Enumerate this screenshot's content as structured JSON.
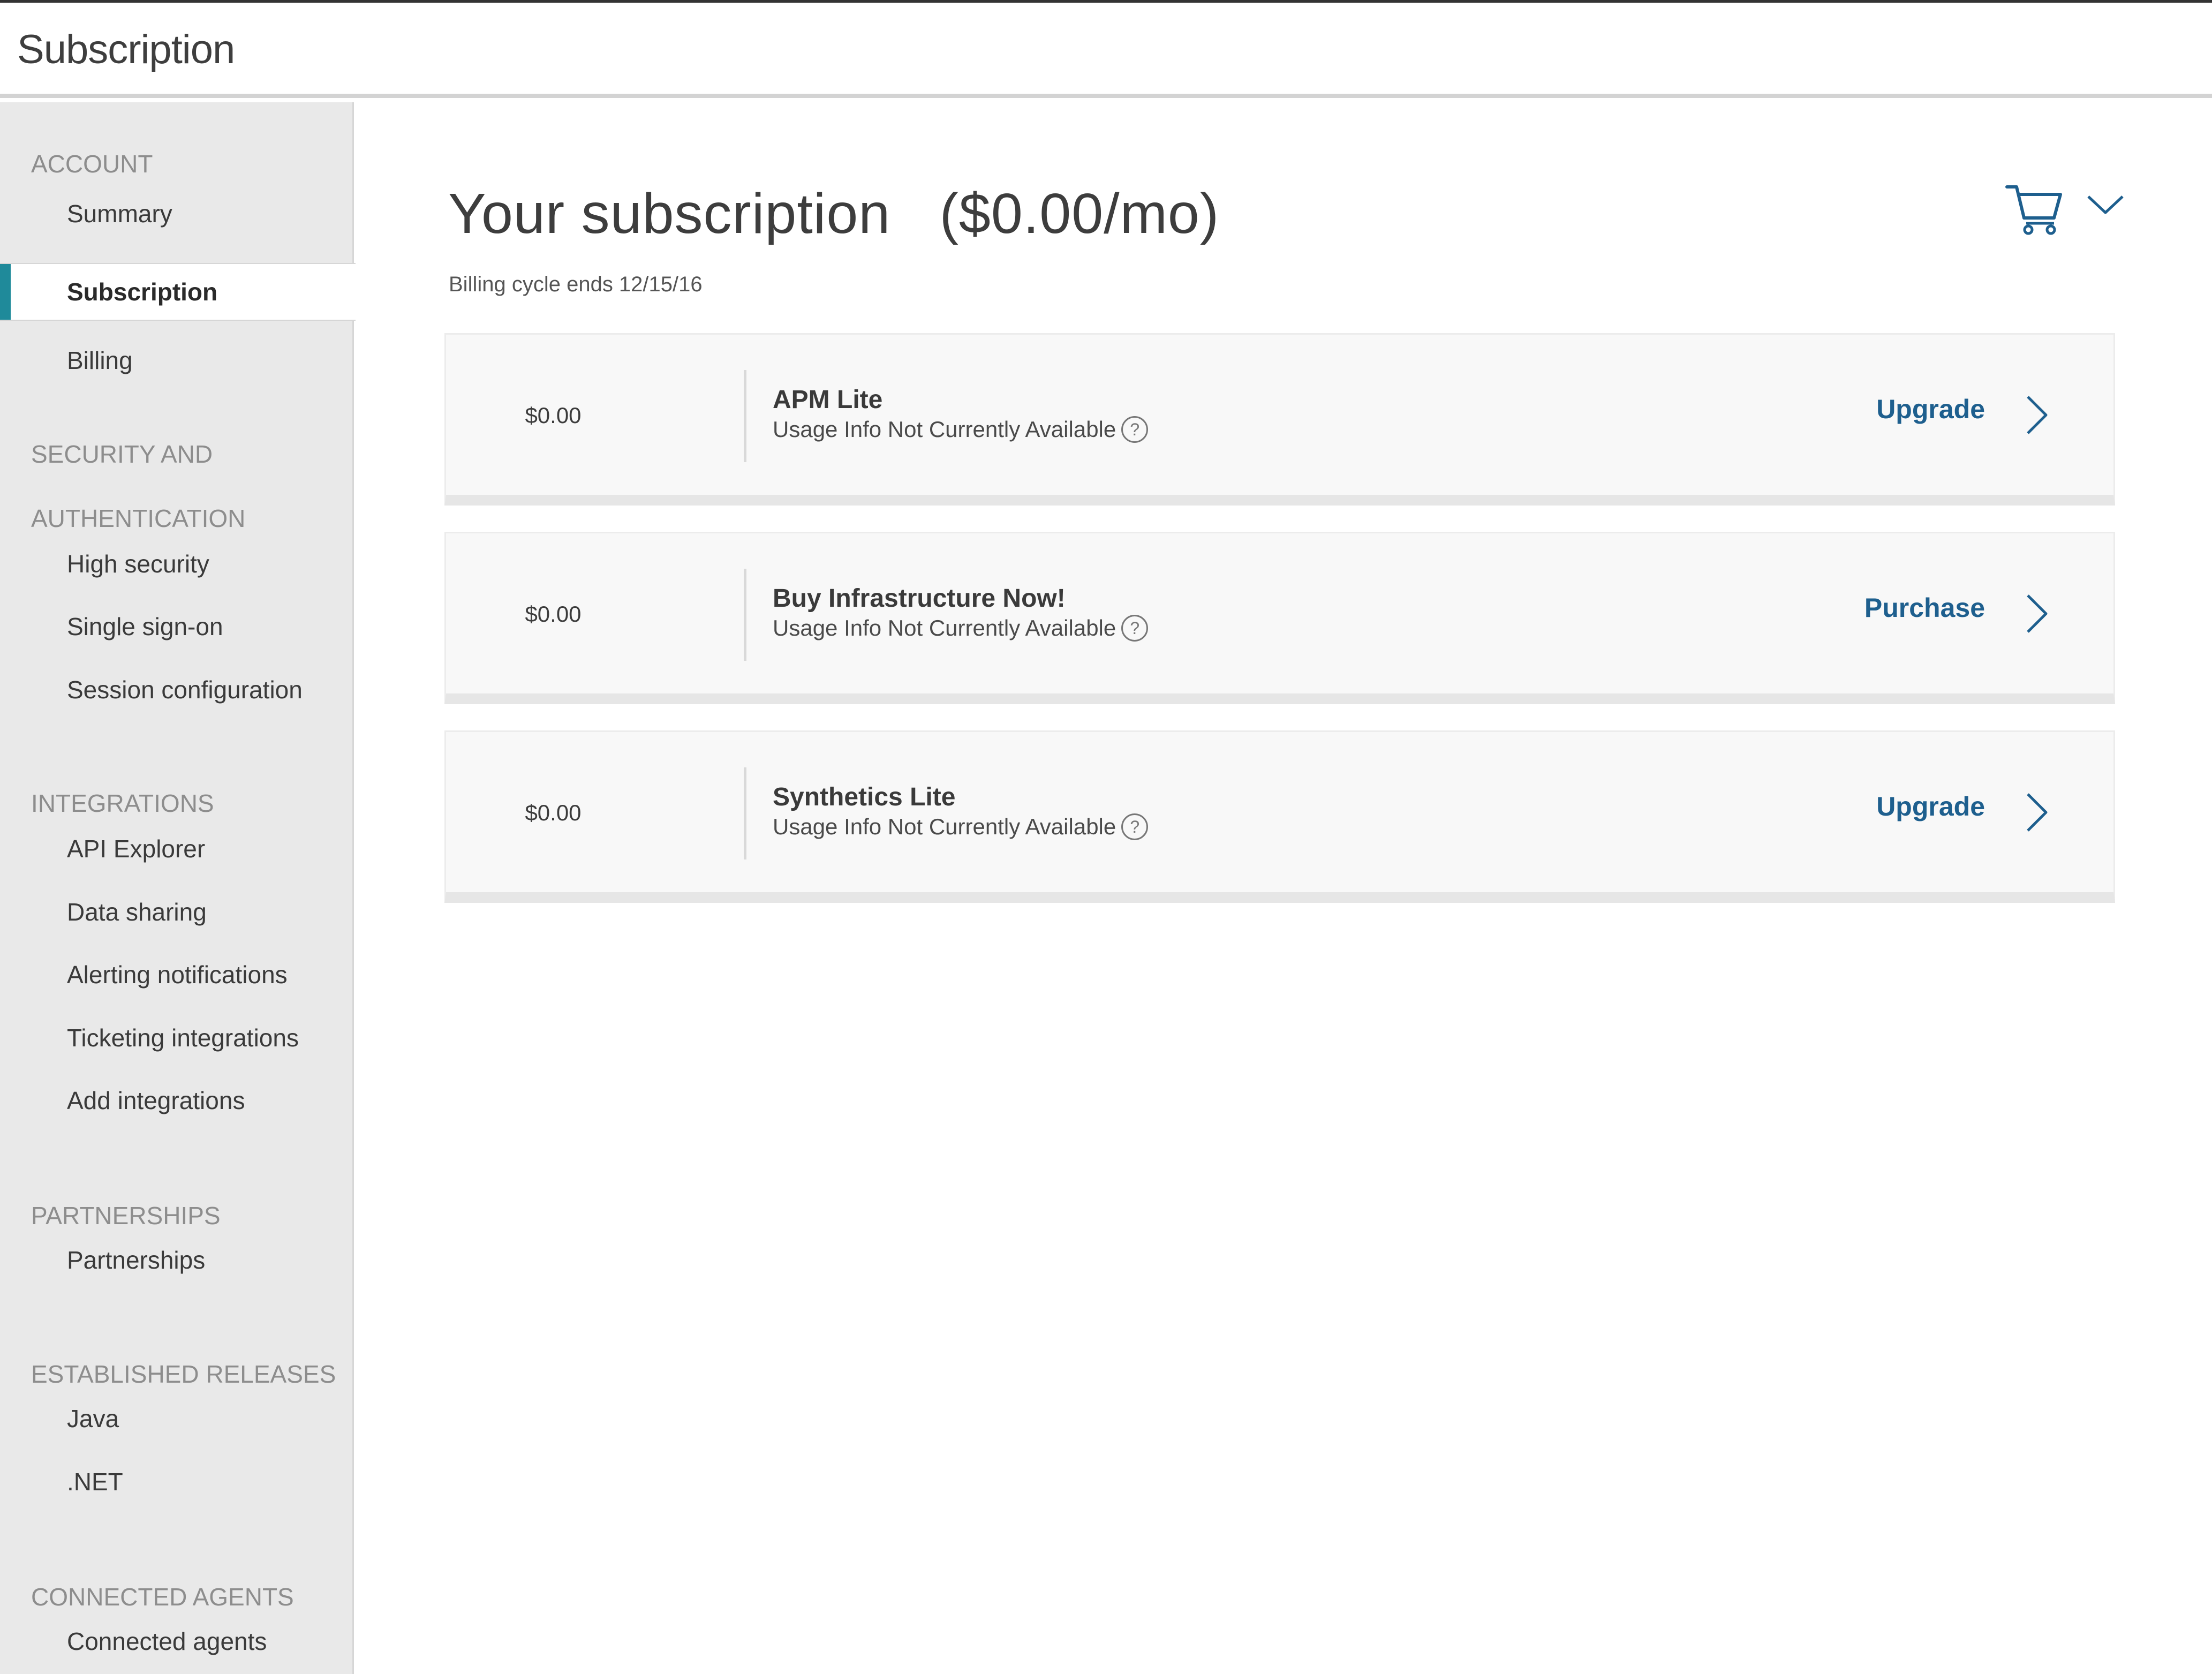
{
  "header": {
    "title": "Subscription"
  },
  "sidebar": {
    "sections": [
      {
        "title": "ACCOUNT",
        "items": [
          "Summary",
          "Subscription",
          "Billing"
        ]
      },
      {
        "title_lines": [
          "SECURITY AND",
          "AUTHENTICATION"
        ],
        "items": [
          "High security",
          "Single sign-on",
          "Session configuration"
        ]
      },
      {
        "title": "INTEGRATIONS",
        "items": [
          "API Explorer",
          "Data sharing",
          "Alerting notifications",
          "Ticketing integrations",
          "Add integrations"
        ]
      },
      {
        "title": "PARTNERSHIPS",
        "items": [
          "Partnerships"
        ]
      },
      {
        "title": "ESTABLISHED RELEASES",
        "items": [
          "Java",
          ".NET"
        ]
      },
      {
        "title": "CONNECTED AGENTS",
        "items": [
          "Connected agents"
        ]
      }
    ],
    "active_item": "Subscription"
  },
  "main": {
    "title": "Your subscription",
    "price_per_month": "($0.00/mo)",
    "billing_cycle": "Billing cycle ends 12/15/16",
    "products": [
      {
        "price": "$0.00",
        "name": "APM Lite",
        "usage": "Usage Info Not Currently Available",
        "action": "Upgrade"
      },
      {
        "price": "$0.00",
        "name": "Buy Infrastructure Now!",
        "usage": "Usage Info Not Currently Available",
        "action": "Purchase"
      },
      {
        "price": "$0.00",
        "name": "Synthetics Lite",
        "usage": "Usage Info Not Currently Available",
        "action": "Upgrade"
      }
    ],
    "help_glyph": "?"
  },
  "colors": {
    "accent": "#1f8a9a",
    "link": "#1e5f8e",
    "sidebar_bg": "#e9e9e9",
    "section_header": "#8d8d8d"
  },
  "icons": {
    "cart": "shopping-cart-icon",
    "caret": "chevron-down-icon",
    "help": "question-circle-icon",
    "chevron": "chevron-right-icon"
  }
}
